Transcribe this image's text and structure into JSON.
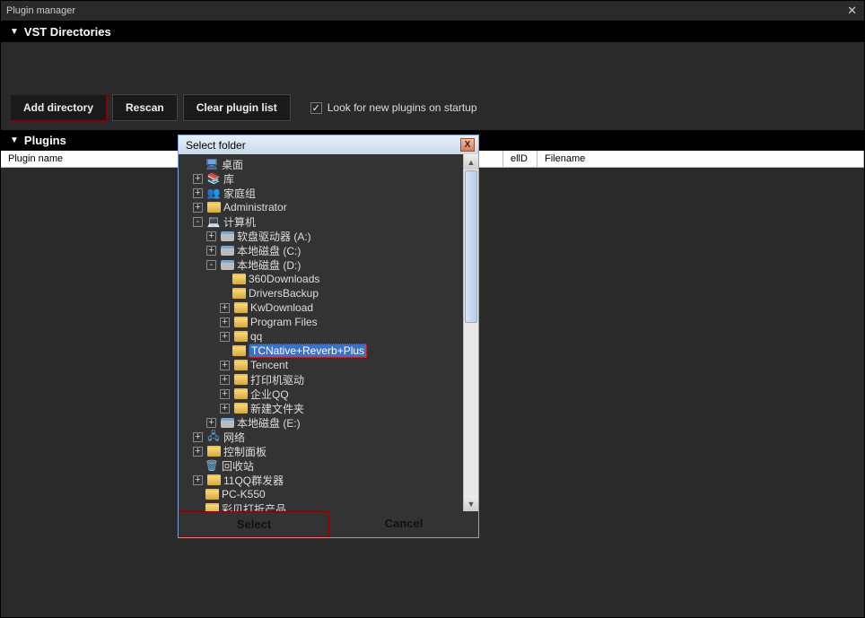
{
  "window": {
    "title": "Plugin manager"
  },
  "sections": {
    "vst": "VST Directories",
    "plugins": "Plugins"
  },
  "buttons": {
    "add_directory": "Add directory",
    "rescan": "Rescan",
    "clear": "Clear plugin list"
  },
  "checkbox": {
    "startup_label": "Look for new plugins on startup",
    "checked": true
  },
  "columns": {
    "plugin_name": "Plugin name",
    "cell_id": "ellD",
    "filename": "Filename"
  },
  "dialog": {
    "title": "Select folder",
    "select": "Select",
    "cancel": "Cancel",
    "tree": [
      {
        "depth": 0,
        "exp": "",
        "icon": "desktop",
        "label": "桌面"
      },
      {
        "depth": 0,
        "exp": "+",
        "icon": "lib",
        "label": "库"
      },
      {
        "depth": 0,
        "exp": "+",
        "icon": "home",
        "label": "家庭组"
      },
      {
        "depth": 0,
        "exp": "+",
        "icon": "user",
        "label": "Administrator"
      },
      {
        "depth": 0,
        "exp": "-",
        "icon": "computer",
        "label": "计算机"
      },
      {
        "depth": 1,
        "exp": "+",
        "icon": "floppy",
        "label": "软盘驱动器 (A:)"
      },
      {
        "depth": 1,
        "exp": "+",
        "icon": "drive",
        "label": "本地磁盘 (C:)"
      },
      {
        "depth": 1,
        "exp": "-",
        "icon": "drive",
        "label": "本地磁盘 (D:)"
      },
      {
        "depth": 2,
        "exp": "",
        "icon": "folder",
        "label": "360Downloads"
      },
      {
        "depth": 2,
        "exp": "",
        "icon": "folder",
        "label": "DriversBackup"
      },
      {
        "depth": 2,
        "exp": "+",
        "icon": "folder",
        "label": "KwDownload"
      },
      {
        "depth": 2,
        "exp": "+",
        "icon": "folder",
        "label": "Program Files"
      },
      {
        "depth": 2,
        "exp": "+",
        "icon": "folder",
        "label": "qq"
      },
      {
        "depth": 2,
        "exp": "",
        "icon": "folder",
        "label": "TCNative+Reverb+Plus",
        "selected": true
      },
      {
        "depth": 2,
        "exp": "+",
        "icon": "folder",
        "label": "Tencent"
      },
      {
        "depth": 2,
        "exp": "+",
        "icon": "folder",
        "label": "打印机驱动"
      },
      {
        "depth": 2,
        "exp": "+",
        "icon": "folder",
        "label": "企业QQ"
      },
      {
        "depth": 2,
        "exp": "+",
        "icon": "folder",
        "label": "新建文件夹"
      },
      {
        "depth": 1,
        "exp": "+",
        "icon": "drive",
        "label": "本地磁盘 (E:)"
      },
      {
        "depth": 0,
        "exp": "+",
        "icon": "network",
        "label": "网络"
      },
      {
        "depth": 0,
        "exp": "+",
        "icon": "cpanel",
        "label": "控制面板"
      },
      {
        "depth": 0,
        "exp": "",
        "icon": "recycle",
        "label": "回收站"
      },
      {
        "depth": 0,
        "exp": "+",
        "icon": "folder",
        "label": "11QQ群发器"
      },
      {
        "depth": 0,
        "exp": "",
        "icon": "folder",
        "label": "PC-K550"
      },
      {
        "depth": 0,
        "exp": "",
        "icon": "folder",
        "label": "彩贝打折产品"
      }
    ]
  }
}
